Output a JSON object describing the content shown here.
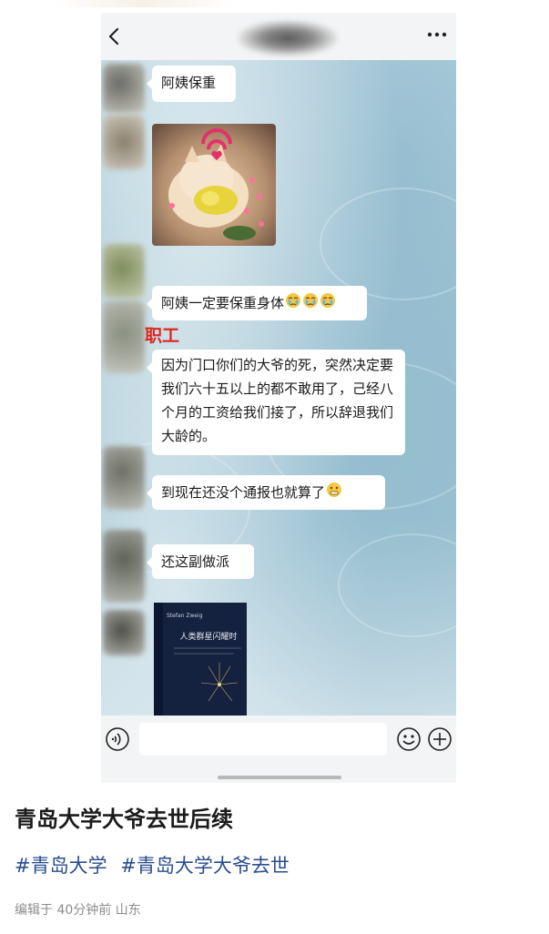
{
  "chat": {
    "messages": [
      {
        "type": "text",
        "text": "阿姨保重"
      },
      {
        "type": "sticker",
        "icon": "cat-sticker"
      },
      {
        "type": "text",
        "text": "阿姨一定要保重身体",
        "emojis": [
          "crying-face",
          "crying-face",
          "crying-face"
        ]
      },
      {
        "type": "text",
        "text": "因为门口你们的大爷的死，突然决定要我们六十五以上的都不敢用了，己经八个月的工资给我们接了，所以辞退我们大龄的。"
      },
      {
        "type": "text",
        "text": "到现在还没个通报也就算了",
        "emojis": [
          "grimace-face"
        ]
      },
      {
        "type": "text",
        "text": "还这副做派"
      },
      {
        "type": "image",
        "book_title": "人类群星闪耀时"
      }
    ],
    "annotation": "职工"
  },
  "post": {
    "title": "青岛大学大爷去世后续",
    "hashtags": [
      "#青岛大学",
      "#青岛大学大爷去世"
    ],
    "meta": "编辑于 40分钟前 山东"
  },
  "colors": {
    "annotation": "#e0261e",
    "hashtag": "#2a4d8f",
    "meta": "#8c8c8c"
  }
}
